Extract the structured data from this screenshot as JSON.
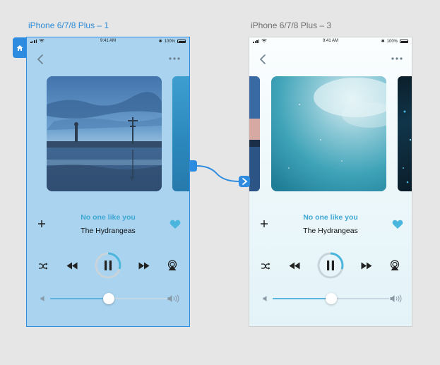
{
  "artboards": [
    {
      "label": "iPhone 6/7/8 Plus – 1",
      "status_time": "9:41 AM",
      "battery_text": "100%",
      "song": {
        "title": "No one like you",
        "artist": "The Hydrangeas"
      },
      "volume_fraction": 0.5,
      "playback_progress_fraction": 0.3,
      "selected": true
    },
    {
      "label": "iPhone 6/7/8 Plus – 3",
      "status_time": "9:41 AM",
      "battery_text": "100%",
      "song": {
        "title": "No one like you",
        "artist": "The Hydrangeas"
      },
      "volume_fraction": 0.5,
      "playback_progress_fraction": 0.3,
      "selected": false
    }
  ],
  "icons": [
    "home-icon",
    "back-chevron-icon",
    "more-dots-icon",
    "plus-icon",
    "heart-icon",
    "shuffle-icon",
    "rewind-icon",
    "pause-icon",
    "fast-forward-icon",
    "airplay-icon",
    "volume-low-icon",
    "volume-high-icon",
    "chevron-right-icon"
  ],
  "colors": {
    "canvas": "#e6e6e6",
    "selection": "#2f8de2",
    "accent": "#3fa7d3",
    "heart": "#4ab6dd",
    "artboard1_bg": "#a9d3ef",
    "artboard3_bg": "#eef8fb"
  }
}
